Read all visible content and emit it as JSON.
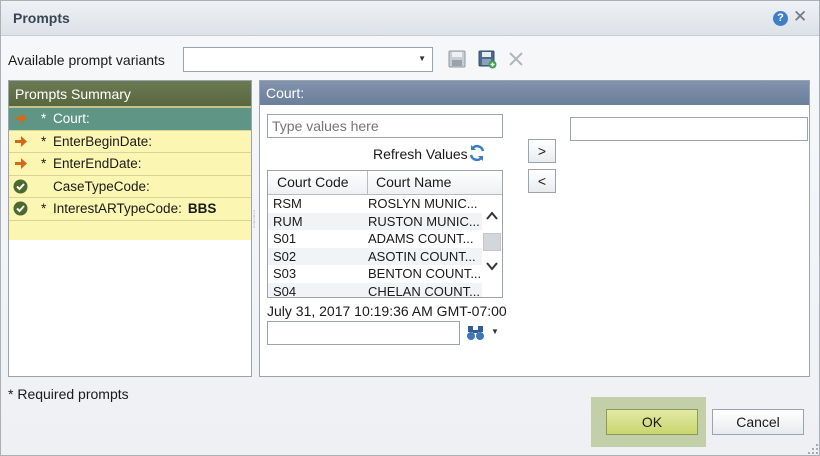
{
  "window": {
    "title": "Prompts"
  },
  "toolbar": {
    "variants_label": "Available prompt variants",
    "variants_value": ""
  },
  "summary": {
    "title": "Prompts Summary",
    "items": [
      {
        "required": "*",
        "label": "Court:",
        "value": "",
        "status": "arrow",
        "selected": true
      },
      {
        "required": "*",
        "label": "EnterBeginDate:",
        "value": "",
        "status": "arrow",
        "selected": false
      },
      {
        "required": "*",
        "label": "EnterEndDate:",
        "value": "",
        "status": "arrow",
        "selected": false
      },
      {
        "required": "",
        "label": "CaseTypeCode:",
        "value": "",
        "status": "check",
        "selected": false
      },
      {
        "required": "*",
        "label": "InterestARTypeCode:",
        "value": "BBS",
        "status": "check",
        "selected": false
      }
    ]
  },
  "court_panel": {
    "title": "Court:",
    "type_placeholder": "Type values here",
    "refresh_label": "Refresh Values",
    "columns": [
      "Court Code",
      "Court Name"
    ],
    "rows": [
      {
        "code": "RSM",
        "name": "ROSLYN MUNIC..."
      },
      {
        "code": "RUM",
        "name": "RUSTON MUNIC..."
      },
      {
        "code": "S01",
        "name": "ADAMS COUNT..."
      },
      {
        "code": "S02",
        "name": "ASOTIN COUNT..."
      },
      {
        "code": "S03",
        "name": "BENTON COUNT..."
      },
      {
        "code": "S04",
        "name": "CHELAN COUNT..."
      }
    ],
    "timestamp": "July 31, 2017 10:19:36 AM GMT-07:00",
    "search_value": "",
    "move_right_label": ">",
    "move_left_label": "<",
    "selected_value": ""
  },
  "footer": {
    "required_note": "* Required prompts",
    "ok_label": "OK",
    "cancel_label": "Cancel"
  },
  "colors": {
    "summary_header": "#5e6a44",
    "selected_row": "#5e9585",
    "row_background": "#fbf6b2",
    "panel_header": "#7386a2",
    "ok_button": "#d3dd86"
  },
  "icons": {
    "help": "help-icon",
    "close": "close-icon",
    "save": "save-icon",
    "save_as": "save-as-icon",
    "delete": "delete-icon",
    "refresh": "refresh-icon",
    "search": "binoculars-icon",
    "status_arrow": "arrow-right-icon",
    "status_check": "checkmark-icon"
  }
}
